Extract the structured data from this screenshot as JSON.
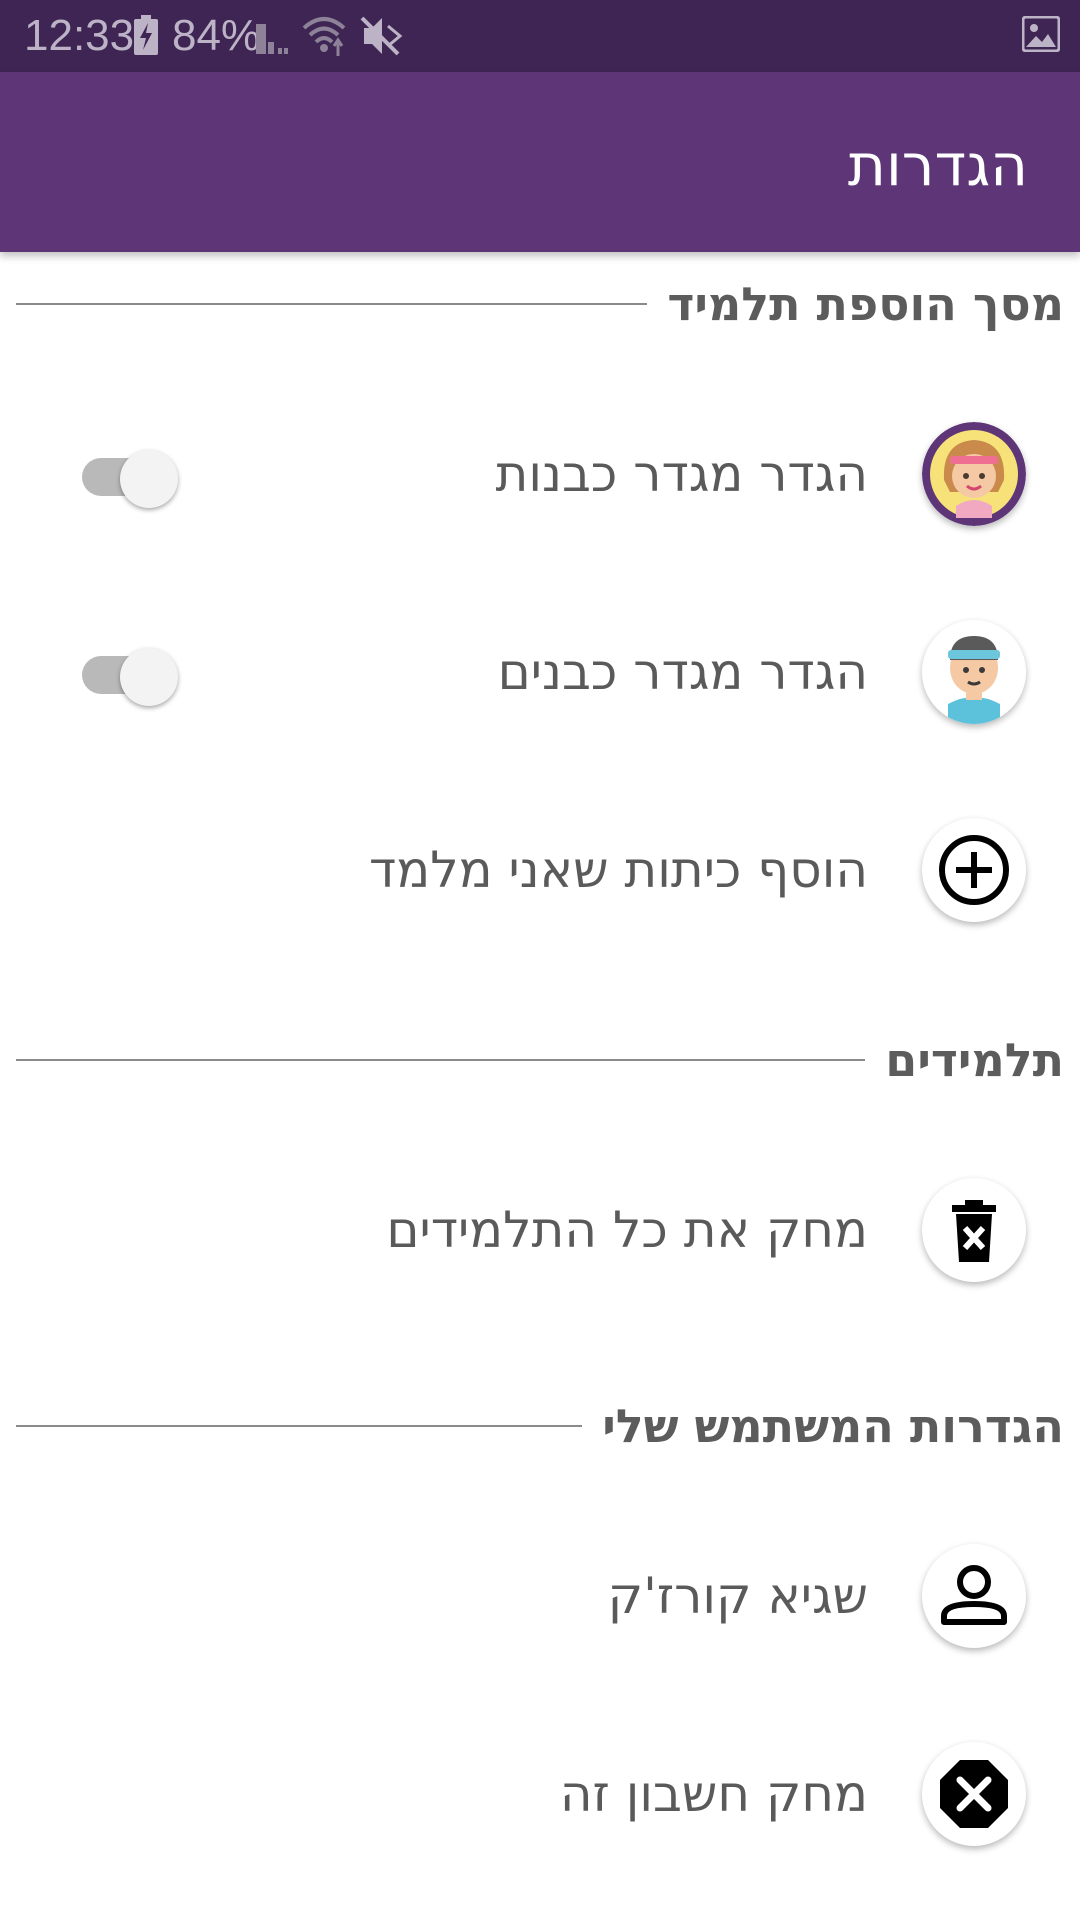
{
  "status_bar": {
    "time": "12:33",
    "battery": "84%",
    "icons": [
      "battery-charging-icon",
      "signal-icon",
      "wifi-icon",
      "mute-icon",
      "image-icon"
    ]
  },
  "app_bar": {
    "title": "הגדרות"
  },
  "sections": {
    "add_student_screen": {
      "title": "מסך הוספת תלמיד",
      "items": {
        "girls_gender": {
          "label": "הגדר מגדר כבנות",
          "icon": "girl-avatar-icon",
          "toggle_on": false
        },
        "boys_gender": {
          "label": "הגדר מגדר כבנים",
          "icon": "boy-avatar-icon",
          "toggle_on": false
        },
        "add_classes": {
          "label": "הוסף כיתות שאני מלמד",
          "icon": "add-circle-icon"
        }
      }
    },
    "students": {
      "title": "תלמידים",
      "items": {
        "delete_all": {
          "label": "מחק את כל התלמידים",
          "icon": "delete-icon"
        }
      }
    },
    "user_settings": {
      "title": "הגדרות המשתמש שלי",
      "items": {
        "user_name": {
          "label": "שגיא קורז'ק",
          "icon": "person-icon"
        },
        "delete_account": {
          "label": "מחק חשבון זה",
          "icon": "cancel-icon"
        }
      }
    }
  },
  "colors": {
    "status_bar": "#3e2553",
    "app_bar": "#5e3678",
    "section_text": "#5c5c5c",
    "row_text": "#5a5a5a",
    "toggle_track": "#b9b9b9"
  }
}
